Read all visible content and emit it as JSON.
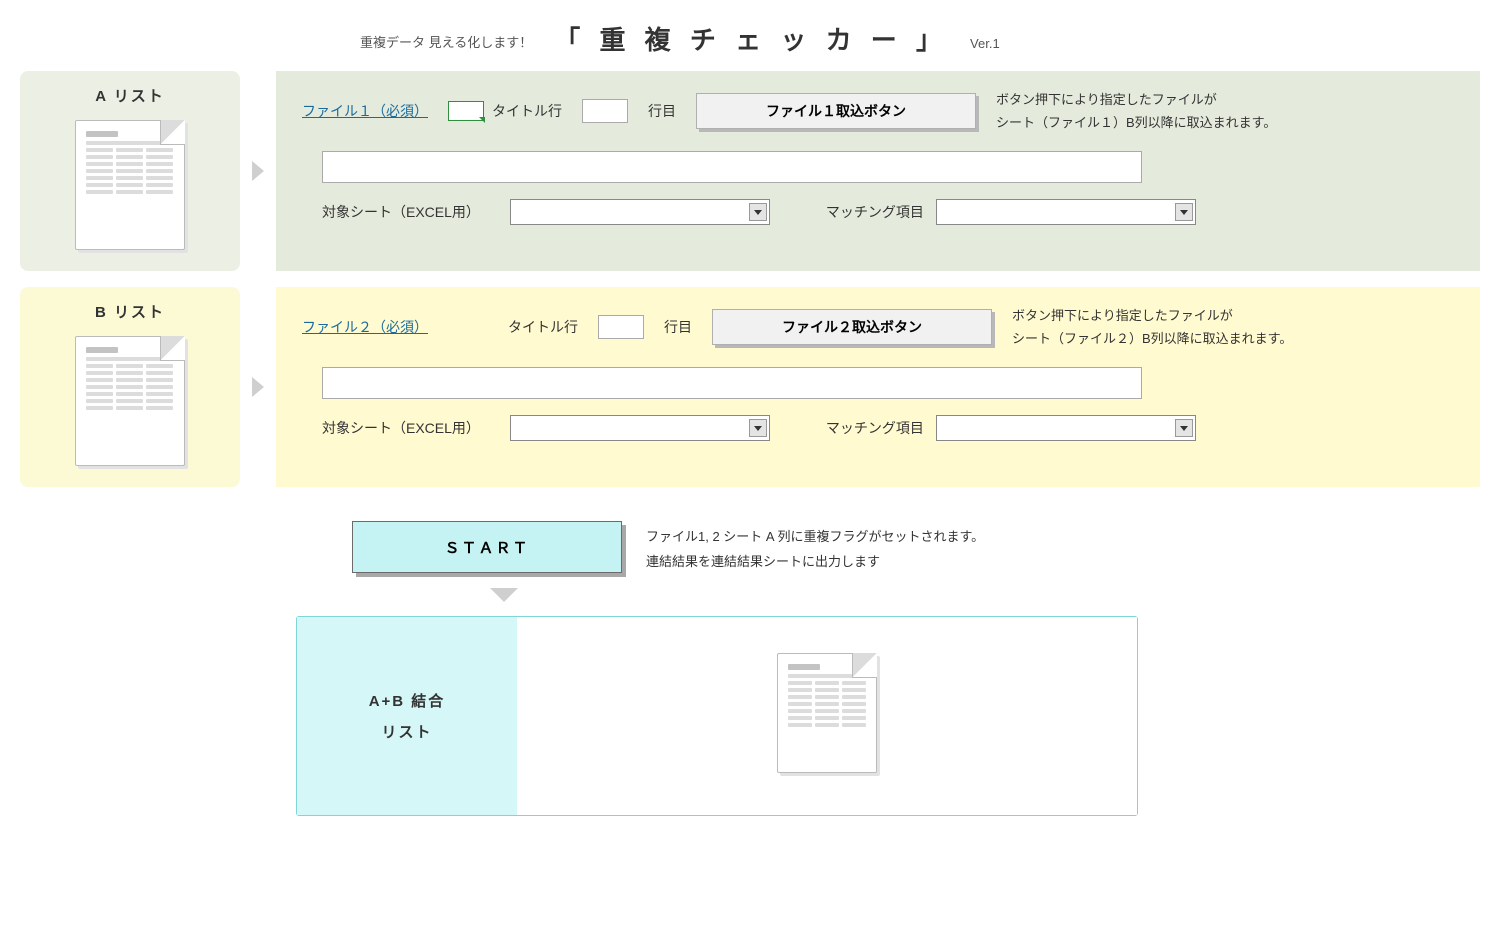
{
  "header": {
    "subtitle": "重複データ 見える化します！",
    "title": "「 重 複 チ ェ ッ カ ー 」",
    "version": "Ver.1"
  },
  "sectionA": {
    "tag": "A リスト",
    "file_link": "ファイル１（必須）",
    "title_row_label": "タイトル行",
    "row_suffix": "行目",
    "row_value": "",
    "import_button": "ファイル１取込ボタン",
    "hint_line1": "ボタン押下により指定したファイルが",
    "hint_line2": "シート（ファイル１）B列以降に取込まれます。",
    "path_value": "",
    "target_sheet_label": "対象シート（EXCEL用）",
    "target_sheet_value": "",
    "matching_label": "マッチング項目",
    "matching_value": ""
  },
  "sectionB": {
    "tag": "B リスト",
    "file_link": "ファイル２（必須）",
    "title_row_label": "タイトル行",
    "row_suffix": "行目",
    "row_value": "",
    "import_button": "ファイル２取込ボタン",
    "hint_line1": "ボタン押下により指定したファイルが",
    "hint_line2": "シート（ファイル２）B列以降に取込まれます。",
    "path_value": "",
    "target_sheet_label": "対象シート（EXCEL用）",
    "target_sheet_value": "",
    "matching_label": "マッチング項目",
    "matching_value": ""
  },
  "start": {
    "button": "ＳＴＡＲＴ",
    "hint_line1": "ファイル1, 2 シート A 列に重複フラグがセットされます。",
    "hint_line2": "連結結果を連結結果シートに出力します"
  },
  "result": {
    "line1": "A+B 結合",
    "line2": "リスト"
  }
}
